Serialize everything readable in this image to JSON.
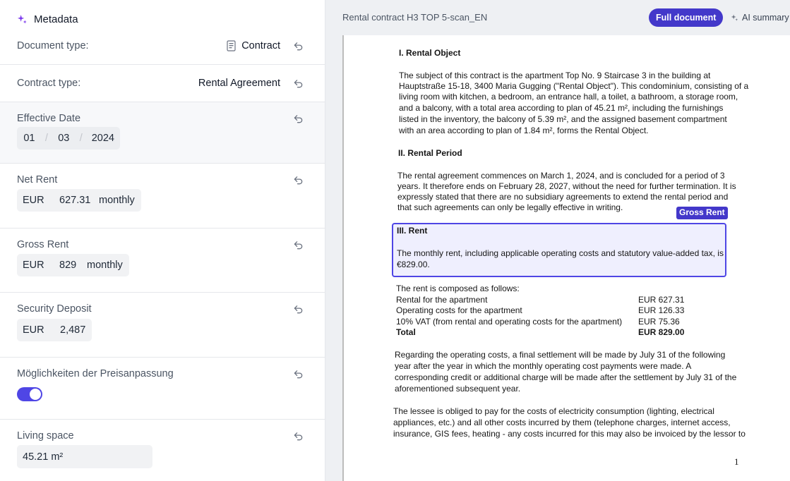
{
  "metadata": {
    "title": "Metadata",
    "document_type": {
      "label": "Document type:",
      "value": "Contract"
    },
    "contract_type": {
      "label": "Contract type:",
      "value": "Rental Agreement"
    },
    "effective_date": {
      "label": "Effective Date",
      "day": "01",
      "month": "03",
      "year": "2024",
      "separator": "/"
    },
    "net_rent": {
      "label": "Net Rent",
      "currency": "EUR",
      "amount": "627.31",
      "period": "monthly"
    },
    "gross_rent": {
      "label": "Gross Rent",
      "currency": "EUR",
      "amount": "829",
      "period": "monthly"
    },
    "security_deposit": {
      "label": "Security Deposit",
      "currency": "EUR",
      "amount": "2,487"
    },
    "price_adjustment": {
      "label": "Möglichkeiten der Preisanpassung",
      "enabled": true
    },
    "living_space": {
      "label": "Living space",
      "value": "45.21 m²"
    }
  },
  "viewer": {
    "doc_title": "Rental contract H3 TOP 5-scan_EN",
    "full_document_label": "Full document",
    "ai_summary_label": "AI summary",
    "highlight_tag": "Gross Rent",
    "page_number": "1",
    "sections": {
      "s1_heading": "I. Rental Object",
      "s1_lines": [
        "The subject of this contract is the apartment Top No. 9 Staircase 3 in the building at",
        "Hauptstraße 15-18, 3400 Maria Gugging (\"Rental Object\"). This condominium, consisting of a",
        "living room with kitchen, a bedroom, an entrance hall, a toilet, a bathroom, a storage room,",
        "and a balcony, with a total area according to plan of 45.21 m², including the furnishings",
        "listed in the inventory, the balcony of 5.39 m², and the assigned basement compartment",
        "with an area according to plan of 1.84 m², forms the Rental Object."
      ],
      "s2_heading": "II. Rental Period",
      "s2_lines": [
        "The rental agreement commences on March 1, 2024, and is concluded for a period of 3",
        "years. It therefore ends on February 28, 2027, without the need for further termination. It is",
        "expressly stated that there are no subsidiary agreements to extend the rental period and",
        "that such agreements can only be legally effective in writing."
      ],
      "s3_heading": "III. Rent",
      "s3_lines": [
        "The monthly rent, including applicable operating costs and statutory value-added tax, is",
        "€829.00."
      ],
      "composition_intro": "The rent is composed as follows:",
      "composition_rows": [
        {
          "label": "Rental for the apartment",
          "value": "EUR 627.31"
        },
        {
          "label": "Operating costs for the apartment",
          "value": "EUR 126.33"
        },
        {
          "label": "10% VAT (from rental and operating costs for the apartment)",
          "value": "EUR 75.36"
        },
        {
          "label": "Total",
          "value": "EUR 829.00"
        }
      ],
      "p_operating": [
        "Regarding the operating costs, a final settlement will be made by July 31 of the following",
        "year after the year in which the monthly operating cost payments were made. A",
        "corresponding credit or additional charge will be made after the settlement by July 31 of the",
        "aforementioned subsequent year."
      ],
      "p_lessee": [
        "The lessee is obliged to pay for the costs of electricity consumption (lighting, electrical",
        "appliances, etc.) and all other costs incurred by them (telephone charges, internet access,",
        "insurance, GIS fees, heating - any costs incurred for this may also be invoiced by the lessor to"
      ]
    }
  },
  "colors": {
    "accent": "#4338ca",
    "highlight_border": "#4f46e5",
    "sparkle": "#7c3aed"
  },
  "icons": [
    "sparkle-icon",
    "document-icon",
    "undo-icon",
    "ai-sparkle-icon"
  ]
}
